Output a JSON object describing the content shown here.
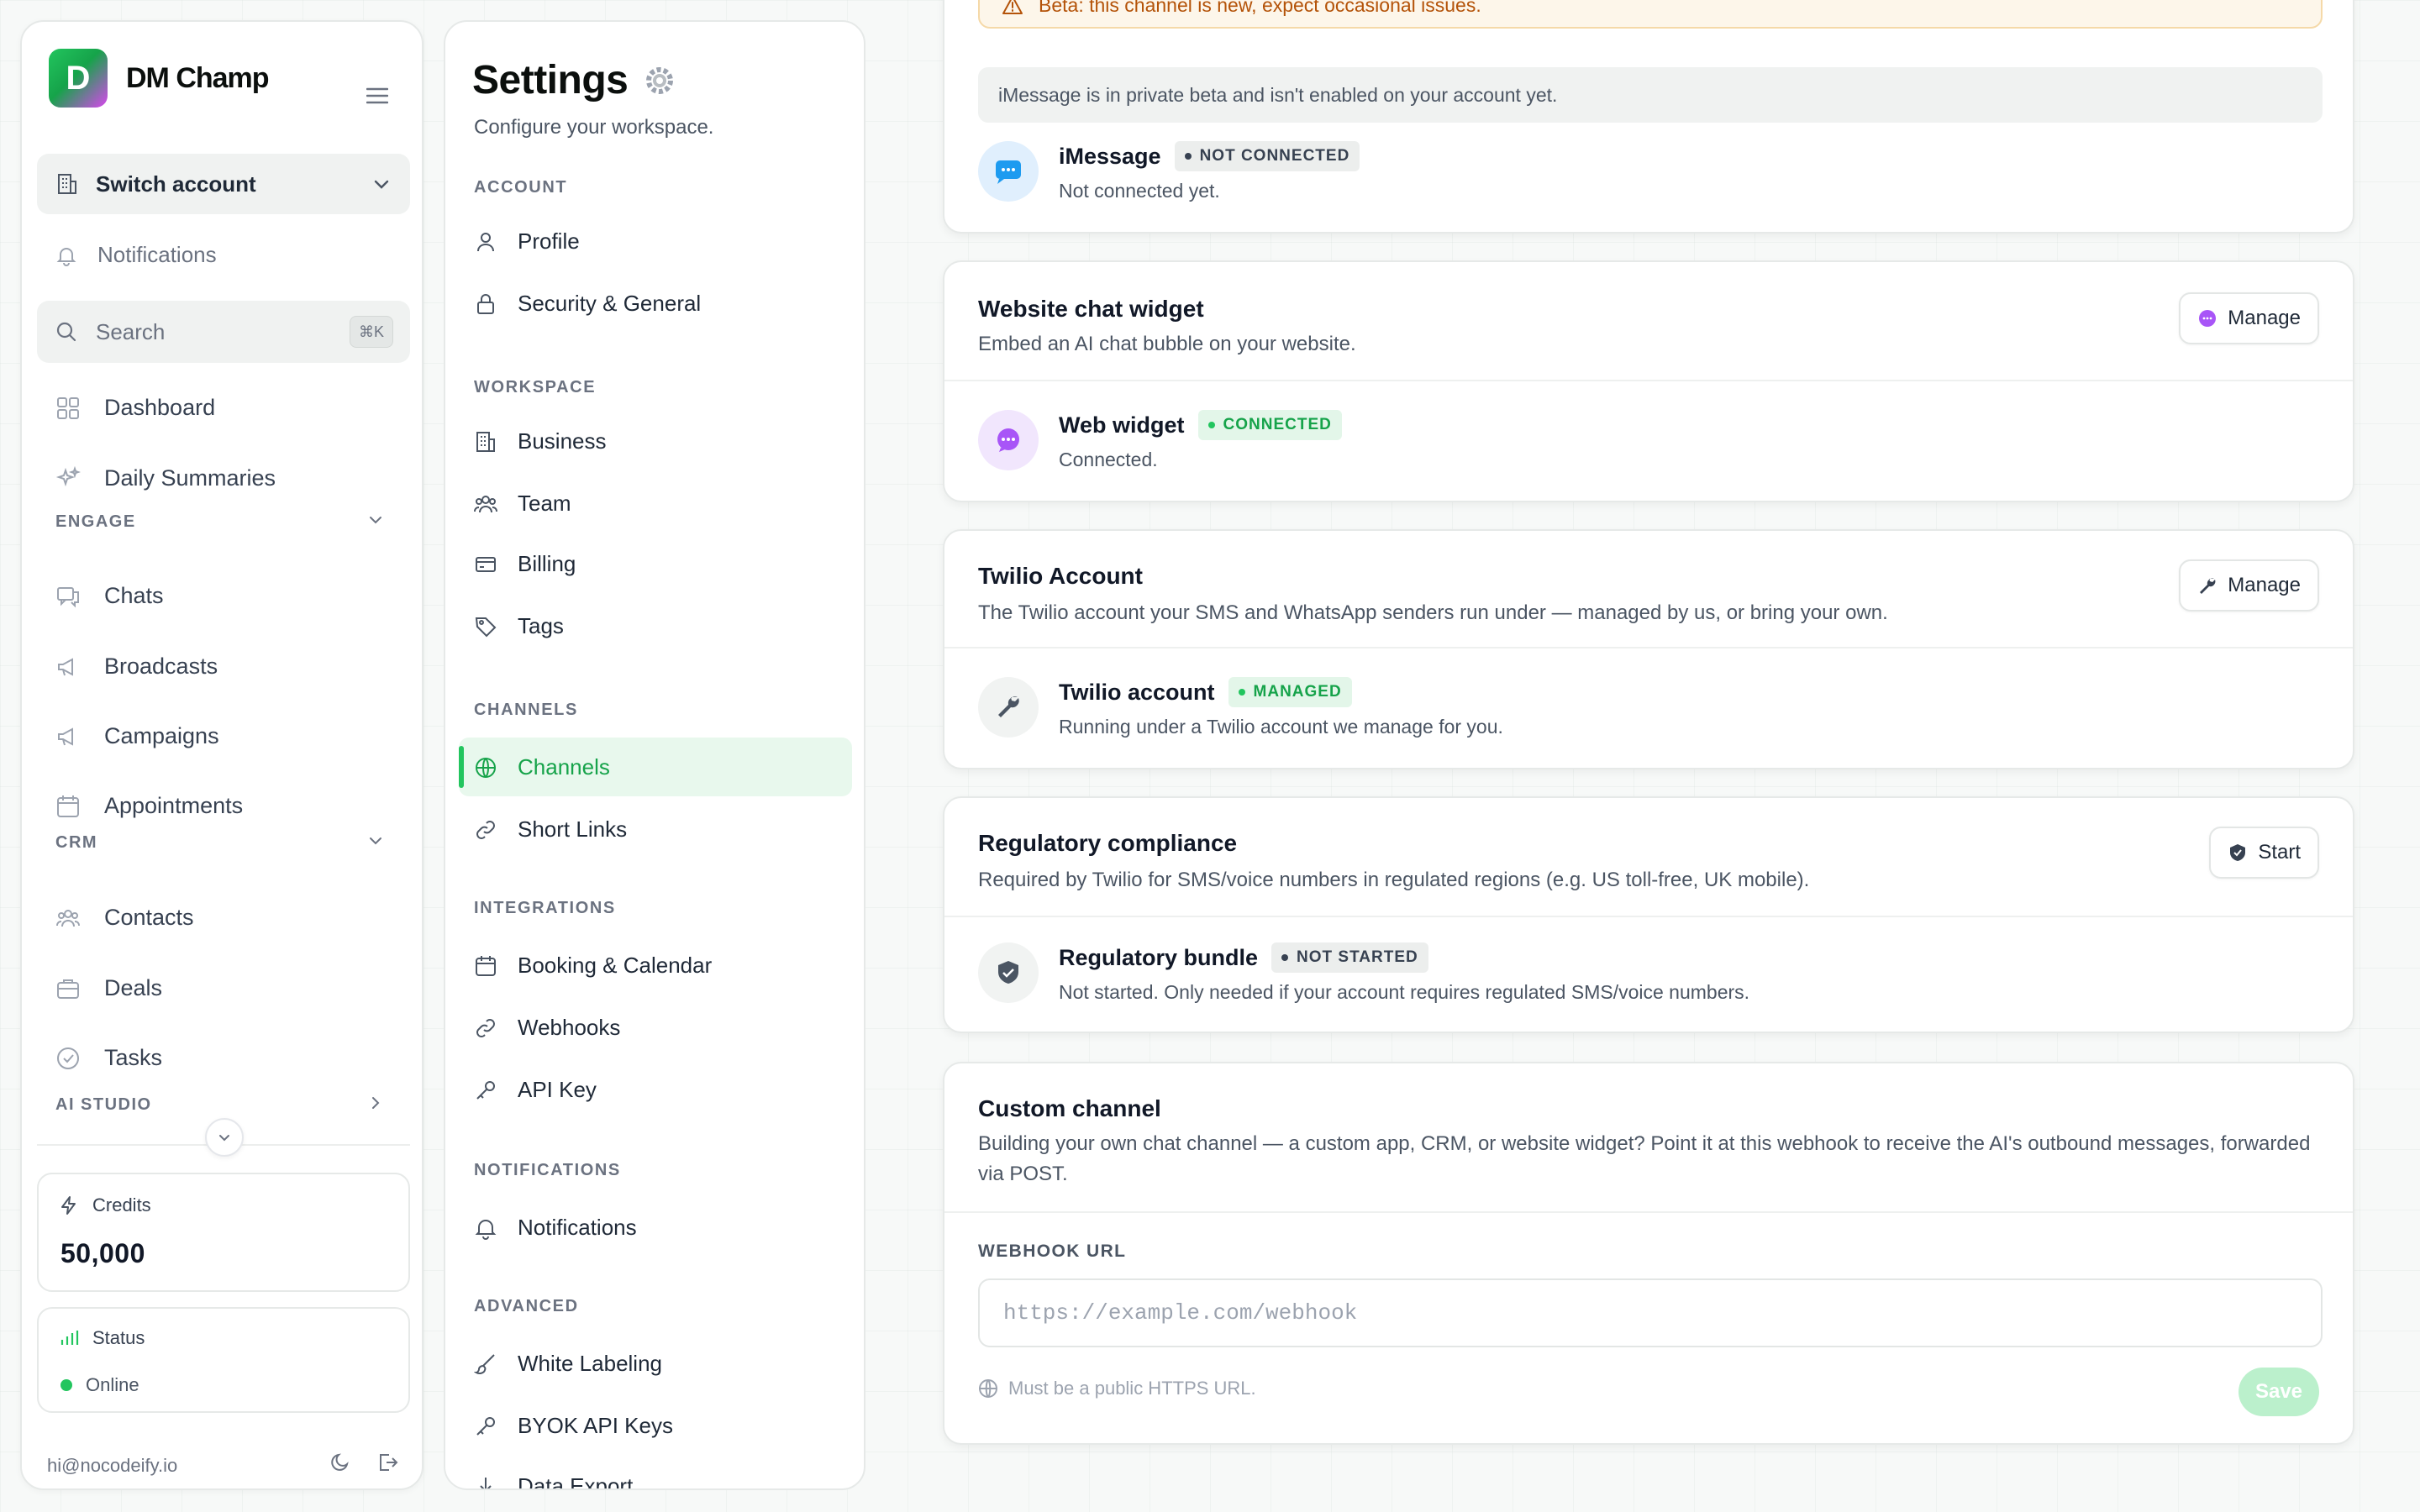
{
  "sidebar": {
    "brand": {
      "logo_letter": "D",
      "name": "DM Champ"
    },
    "switch_account": "Switch account",
    "notifications": "Notifications",
    "search": {
      "placeholder": "Search",
      "shortcut": "⌘K"
    },
    "nav": {
      "dashboard": "Dashboard",
      "daily_summaries": "Daily Summaries",
      "engage_section": "ENGAGE",
      "chats": "Chats",
      "broadcasts": "Broadcasts",
      "campaigns": "Campaigns",
      "appointments": "Appointments",
      "crm_section": "CRM",
      "contacts": "Contacts",
      "deals": "Deals",
      "tasks": "Tasks",
      "ai_studio_section": "AI STUDIO"
    },
    "credits": {
      "label": "Credits",
      "value": "50,000"
    },
    "status": {
      "label": "Status",
      "value": "Online",
      "color": "#22c55e"
    },
    "footer_email": "hi@nocodeify.io"
  },
  "settings": {
    "title": "Settings",
    "subtitle": "Configure your workspace.",
    "sections": {
      "account": "ACCOUNT",
      "workspace": "WORKSPACE",
      "channels": "CHANNELS",
      "integrations": "INTEGRATIONS",
      "notifications": "NOTIFICATIONS",
      "advanced": "ADVANCED"
    },
    "items": {
      "profile": "Profile",
      "security": "Security & General",
      "business": "Business",
      "team": "Team",
      "billing": "Billing",
      "tags": "Tags",
      "channels": "Channels",
      "short_links": "Short Links",
      "booking": "Booking & Calendar",
      "webhooks": "Webhooks",
      "api_key": "API Key",
      "notifications": "Notifications",
      "white_labeling": "White Labeling",
      "byok": "BYOK API Keys",
      "data_export": "Data Export"
    },
    "active_item": "Channels"
  },
  "main": {
    "imessage": {
      "beta_banner": "Beta: this channel is new, expect occasional issues.",
      "info": "iMessage is in private beta and isn't enabled on your account yet.",
      "name": "iMessage",
      "badge": "NOT CONNECTED",
      "status": "Not connected yet."
    },
    "web_widget": {
      "title": "Website chat widget",
      "desc": "Embed an AI chat bubble on your website.",
      "button": "Manage",
      "name": "Web widget",
      "badge": "CONNECTED",
      "status": "Connected."
    },
    "twilio": {
      "title": "Twilio Account",
      "desc": "The Twilio account your SMS and WhatsApp senders run under — managed by us, or bring your own.",
      "button": "Manage",
      "name": "Twilio account",
      "badge": "MANAGED",
      "status": "Running under a Twilio account we manage for you."
    },
    "regulatory": {
      "title": "Regulatory compliance",
      "desc": "Required by Twilio for SMS/voice numbers in regulated regions (e.g. US toll-free, UK mobile).",
      "button": "Start",
      "name": "Regulatory bundle",
      "badge": "NOT STARTED",
      "status": "Not started. Only needed if your account requires regulated SMS/voice numbers."
    },
    "custom": {
      "title": "Custom channel",
      "desc": "Building your own chat channel — a custom app, CRM, or website widget? Point it at this webhook to receive the AI's outbound messages, forwarded via POST.",
      "field_label": "WEBHOOK URL",
      "placeholder": "https://example.com/webhook",
      "value": "",
      "hint": "Must be a public HTTPS URL.",
      "save": "Save"
    }
  },
  "colors": {
    "accent": "#22c55e",
    "accent_dark": "#16a34a",
    "warning": "#b45309",
    "imessage_blue": "#1d9bf0",
    "widget_purple": "#a855f7"
  }
}
